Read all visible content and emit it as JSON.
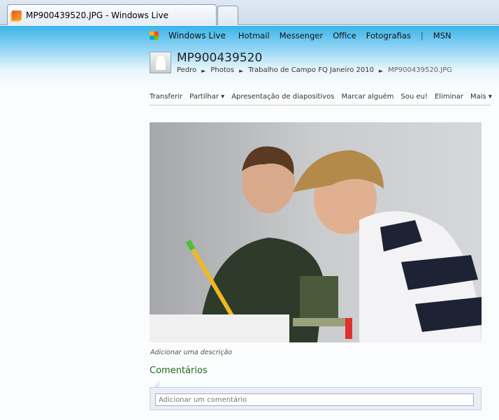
{
  "browser": {
    "tab_title": "MP900439520.JPG - Windows Live"
  },
  "topnav": {
    "brand": "Windows Live",
    "items": [
      "Hotmail",
      "Messenger",
      "Office",
      "Fotografias",
      "MSN"
    ]
  },
  "photo_page": {
    "title": "MP900439520",
    "breadcrumb": [
      "Pedro",
      "Photos",
      "Trabalho de Campo FQ Janeiro 2010",
      "MP900439520.JPG"
    ],
    "actions": [
      "Transferir",
      "Partilhar ▾",
      "Apresentação de diapositivos",
      "Marcar alguém",
      "Sou eu!",
      "Eliminar",
      "Mais ▾"
    ],
    "description_link": "Adicionar uma descrição",
    "comments_heading": "Comentários",
    "comment_placeholder": "Adicionar um comentário"
  }
}
